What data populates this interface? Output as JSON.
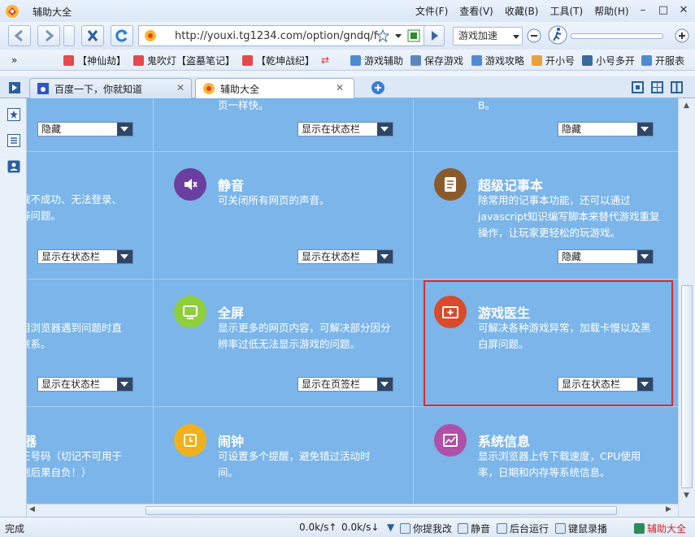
{
  "window": {
    "title": "辅助大全"
  },
  "menu": [
    "文件(F)",
    "查看(V)",
    "收藏(B)",
    "工具(T)",
    "帮助(H)"
  ],
  "nav": {
    "url": "http://youxi.tg1234.com/option/gndq/f",
    "speed_label": "游戏加速"
  },
  "bookmarks": [
    "【神仙劫】",
    "鬼吹灯【盗墓笔记】",
    "【乾坤战纪】",
    "游戏辅助",
    "保存游戏",
    "游戏攻略",
    "开小号",
    "小号多开",
    "开服表"
  ],
  "tabs": [
    {
      "label": "百度一下，你就知道"
    },
    {
      "label": "辅助大全"
    }
  ],
  "features": {
    "top_left_desc": "页一样快。",
    "top_right_desc": "B。",
    "mute": {
      "title": "静音",
      "desc": "可关闭所有网页的声音。"
    },
    "notes": {
      "title": "超级记事本",
      "desc": "除常用的记事本功能，还可以通过javascript知识编写脚本来替代游戏重复操作，让玩家更轻松的玩游戏。"
    },
    "fullscreen": {
      "title": "全屏",
      "desc": "显示更多的网页内容，可解决部分因分辨率过低无法显示游戏的问题。"
    },
    "doctor": {
      "title": "游戏医生",
      "desc": "可解决各种游戏异常，加载卡慢以及黑白屏问题。"
    },
    "alarm": {
      "title": "闹钟",
      "desc": "可设置多个提醒，避免错过活动时间。"
    },
    "sysinfo": {
      "title": "系统信息",
      "desc": "显示浏览器上传下载速度，CPU使用率，日期和内存等系统信息。"
    },
    "left_row2": "载不成功、无法登录、\n等问题。",
    "left_row3": "用浏览器遇到问题时直\n联系。",
    "left_row4_title": "器",
    "left_row4": "正号码（切记不可用于\n则后果自负！）"
  },
  "dropdowns": {
    "r1c1": "隐藏",
    "r1c2": "显示在状态栏",
    "r1c3": "隐藏",
    "r2c1": "显示在状态栏",
    "r2c2": "显示在状态栏",
    "r2c3": "隐藏",
    "r3c1": "显示在状态栏",
    "r3c2": "显示在页签栏",
    "r3c3": "显示在状态栏"
  },
  "status": {
    "done": "完成",
    "speed1": "0.0k/s↑",
    "speed2": "0.0k/s↓",
    "feedback": "你提我改",
    "mute": "静音",
    "background": "后台运行",
    "recorder": "键鼠录播",
    "assist": "辅助大全"
  },
  "colors": {
    "content_bg": "#7bb5e9",
    "mute": "#6b3fa0",
    "notes": "#8a5a2b",
    "fullscreen": "#8fcf3c",
    "doctor": "#d94b2b",
    "alarm": "#f0b21c",
    "sysinfo": "#b150a8",
    "highlight": "#e3262a"
  }
}
